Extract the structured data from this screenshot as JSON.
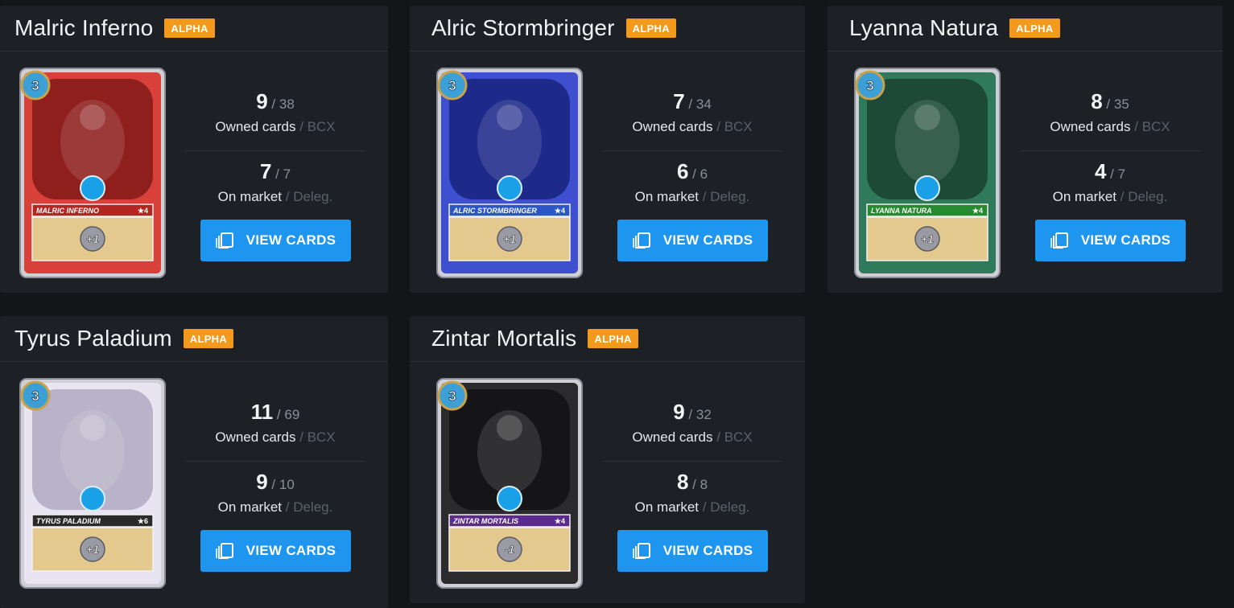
{
  "cards": [
    {
      "name": "Malric Inferno",
      "badge": "ALPHA",
      "owned": "9",
      "owned_total": "38",
      "owned_label": "Owned cards",
      "owned_sub": "BCX",
      "market": "7",
      "market_total": "7",
      "market_label": "On market",
      "market_sub": "Deleg.",
      "button": "VIEW CARDS",
      "card_label": "MALRIC INFERNO",
      "stars": "★4",
      "level": "3",
      "bonus": "+1",
      "color": "#d8403a",
      "color_dark": "#8e1f1c",
      "banner": "#b52620"
    },
    {
      "name": "Alric Stormbringer",
      "badge": "ALPHA",
      "owned": "7",
      "owned_total": "34",
      "owned_label": "Owned cards",
      "owned_sub": "BCX",
      "market": "6",
      "market_total": "6",
      "market_label": "On market",
      "market_sub": "Deleg.",
      "button": "VIEW CARDS",
      "card_label": "ALRIC STORMBRINGER",
      "stars": "★4",
      "level": "3",
      "bonus": "+1",
      "color": "#3e4fd0",
      "color_dark": "#1e2a8a",
      "banner": "#2a56c8"
    },
    {
      "name": "Lyanna Natura",
      "badge": "ALPHA",
      "owned": "8",
      "owned_total": "35",
      "owned_label": "Owned cards",
      "owned_sub": "BCX",
      "market": "4",
      "market_total": "7",
      "market_label": "On market",
      "market_sub": "Deleg.",
      "button": "VIEW CARDS",
      "card_label": "LYANNA NATURA",
      "stars": "★4",
      "level": "3",
      "bonus": "+1",
      "color": "#2f7a5a",
      "color_dark": "#1c4a36",
      "banner": "#268a2e"
    },
    {
      "name": "Tyrus Paladium",
      "badge": "ALPHA",
      "owned": "11",
      "owned_total": "69",
      "owned_label": "Owned cards",
      "owned_sub": "BCX",
      "market": "9",
      "market_total": "10",
      "market_label": "On market",
      "market_sub": "Deleg.",
      "button": "VIEW CARDS",
      "card_label": "TYRUS PALADIUM",
      "stars": "★6",
      "level": "3",
      "bonus": "+1",
      "color": "#e9e4f2",
      "color_dark": "#b9b2c8",
      "banner": "#2a2a2a"
    },
    {
      "name": "Zintar Mortalis",
      "badge": "ALPHA",
      "owned": "9",
      "owned_total": "32",
      "owned_label": "Owned cards",
      "owned_sub": "BCX",
      "market": "8",
      "market_total": "8",
      "market_label": "On market",
      "market_sub": "Deleg.",
      "button": "VIEW CARDS",
      "card_label": "ZINTAR MORTALIS",
      "stars": "★4",
      "level": "3",
      "bonus": "-1",
      "color": "#2b2b2e",
      "color_dark": "#151517",
      "banner": "#5a2a8c"
    }
  ]
}
